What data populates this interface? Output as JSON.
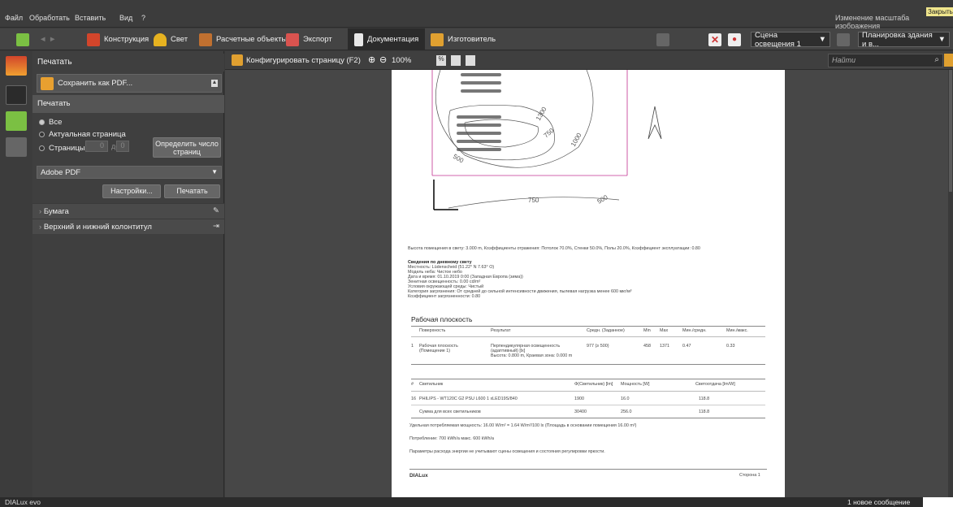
{
  "menu": {
    "items": [
      "Файл",
      "Обработать",
      "Вставить",
      "Вид",
      "?"
    ],
    "right_text": "Изменение масштаба изображения",
    "close_label": "Закрыть"
  },
  "toolbar": {
    "construction": "Конструкция",
    "light": "Свет",
    "calc_objects": "Расчетные объекты",
    "export": "Экспорт",
    "documentation": "Документация",
    "manufacturer": "Изготовитель",
    "scene_select": "Сцена освещения 1",
    "plan_select": "Планировка здания и в..."
  },
  "panel": {
    "print_title": "Печатать",
    "save_pdf": "Сохранить как PDF...",
    "print_section": "Печатать",
    "opt_all": "Все",
    "opt_current": "Актуальная страница",
    "opt_pages": "Страницы",
    "pages_from": "0",
    "pages_to_label": "до",
    "pages_to": "0",
    "define_pages": "Определить число страниц",
    "printer": "Adobe PDF",
    "settings": "Настройки...",
    "print_button": "Печатать",
    "paper": "Бумага",
    "header_footer": "Верхний и нижний колонтитул"
  },
  "docbar": {
    "configure": "Конфигурировать страницу (F2)",
    "zoom": "100%",
    "search_placeholder": "Найти"
  },
  "page": {
    "contours": [
      "1300",
      "750",
      "1000",
      "500",
      "750",
      "500"
    ],
    "room_info": "Высота помещения в свету: 3.000 m, Коэффициенты отражения: Потолок 70.0%, Стенки 50.0%, Полы 20.0%, Коэффициент эксплуатации: 0.80",
    "daylight_title": "Сведения по дневному свету",
    "daylight_lines": [
      "Местность: Lüdenscheid (51.22° N 7.63° O)",
      "Модель неба: Чистое небо",
      "Дата и время: 01.10.2019 0:00 (Западная Европа (зима))",
      "Зенитная освещенность: 0.00 cd/m²",
      "Условия окружающей среды: Чистый",
      "Категория загрязнения: От средней до сильной интенсивности движения, пылевая нагрузка менее 600 мкг/м³",
      "Коэффициент загрязненности: 0.80"
    ],
    "workplane_title": "Рабочая плоскость",
    "wp_headers": [
      "Поверхность",
      "Результат",
      "Средн. (Заданное)",
      "Min",
      "Max",
      "Мин./средн.",
      "Мин./макс."
    ],
    "wp_row": {
      "num": "1",
      "surface1": "Рабочая плоскость",
      "surface2": "(Помещение 1)",
      "result1": "Перпендикулярная освещенность",
      "result2": "(адаптивный) [lx]",
      "result3": "Высота: 0.800 m, Краевая зона: 0.000 m",
      "avg": "977 (≥ 500)",
      "min": "458",
      "max": "1371",
      "min_avg": "0.47",
      "min_max": "0.33"
    },
    "lum_headers": [
      "#",
      "Светильник",
      "Φ(Светильник) [lm]",
      "Мощность [W]",
      "Светоотдача [lm/W]"
    ],
    "lum_row": [
      "16",
      "PHILIPS - WT120C G2 PSU L600 1 xLED19S/840",
      "1900",
      "16.0",
      "118.8"
    ],
    "lum_sum": [
      "Сумма для всех светильников",
      "30400",
      "256.0",
      "118.8"
    ],
    "power_note": "Удельная потребляемая мощность: 16.00 W/m² = 1.64 W/m²/100 lx (Площадь в основании помещения 16.00 m²)",
    "consumption": "Потребление: 700 kWh/a макс. 600 kWh/a",
    "energy_note": "Параметры расхода энергии не учитывают сцены освещения и состояния регулировки яркости.",
    "footer_brand": "DIALux",
    "footer_page": "Сторона 1"
  },
  "status": {
    "app": "DIALux evo",
    "message": "1 новое сообщение"
  }
}
